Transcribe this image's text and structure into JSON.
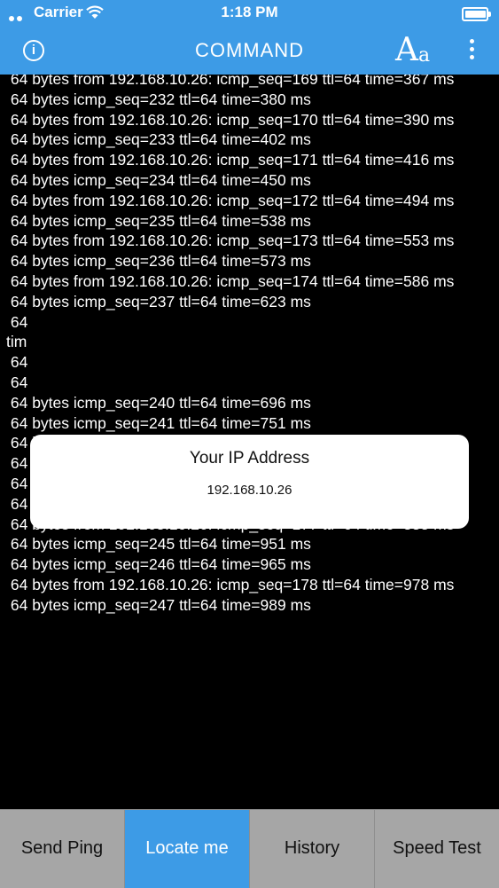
{
  "status_bar": {
    "carrier": "Carrier",
    "time": "1:18 PM",
    "battery_level": 0.9
  },
  "nav": {
    "title": "COMMAND",
    "info_glyph": "i",
    "font_button_big": "A",
    "font_button_small": "a",
    "icons": {
      "info": "info-icon",
      "font": "font-size-icon",
      "more": "more-vertical-icon"
    }
  },
  "terminal_lines": [
    " 64 bytes from 192.168.10.26: icmp_seq=169 ttl=64 time=367 ms",
    " 64 bytes icmp_seq=232 ttl=64 time=380 ms",
    " 64 bytes from 192.168.10.26: icmp_seq=170 ttl=64 time=390 ms",
    " 64 bytes icmp_seq=233 ttl=64 time=402 ms",
    " 64 bytes from 192.168.10.26: icmp_seq=171 ttl=64 time=416 ms",
    " 64 bytes icmp_seq=234 ttl=64 time=450 ms",
    " 64 bytes from 192.168.10.26: icmp_seq=172 ttl=64 time=494 ms",
    " 64 bytes icmp_seq=235 ttl=64 time=538 ms",
    " 64 bytes from 192.168.10.26: icmp_seq=173 ttl=64 time=553 ms",
    " 64 bytes icmp_seq=236 ttl=64 time=573 ms",
    " 64 bytes from 192.168.10.26: icmp_seq=174 ttl=64 time=586 ms",
    " 64 bytes icmp_seq=237 ttl=64 time=623 ms",
    " 64",
    "tim",
    " 64",
    " 64",
    " 64 bytes icmp_seq=240 ttl=64 time=696 ms",
    " 64 bytes icmp_seq=241 ttl=64 time=751 ms",
    " 64 bytes icmp_seq=242 ttl=64 time=791 ms",
    " 64 bytes from 192.168.10.26: icmp_seq=176 ttl=64 time=802 ms",
    " 64 bytes icmp_seq=243 ttl=64 time=820 ms",
    " 64 bytes icmp_seq=244 ttl=64 time=849 ms",
    " 64 bytes from 192.168.10.26: icmp_seq=177 ttl=64 time=885 ms",
    " 64 bytes icmp_seq=245 ttl=64 time=951 ms",
    " 64 bytes icmp_seq=246 ttl=64 time=965 ms",
    " 64 bytes from 192.168.10.26: icmp_seq=178 ttl=64 time=978 ms",
    " 64 bytes icmp_seq=247 ttl=64 time=989 ms"
  ],
  "popup": {
    "title": "Your IP Address",
    "value": "192.168.10.26"
  },
  "tabs": [
    {
      "label": "Send Ping",
      "active": false
    },
    {
      "label": "Locate me",
      "active": true
    },
    {
      "label": "History",
      "active": false
    },
    {
      "label": "Speed Test",
      "active": false
    }
  ],
  "colors": {
    "accent": "#3d9be6",
    "terminal_bg": "#000000",
    "tab_bg": "#a6a6a6"
  }
}
